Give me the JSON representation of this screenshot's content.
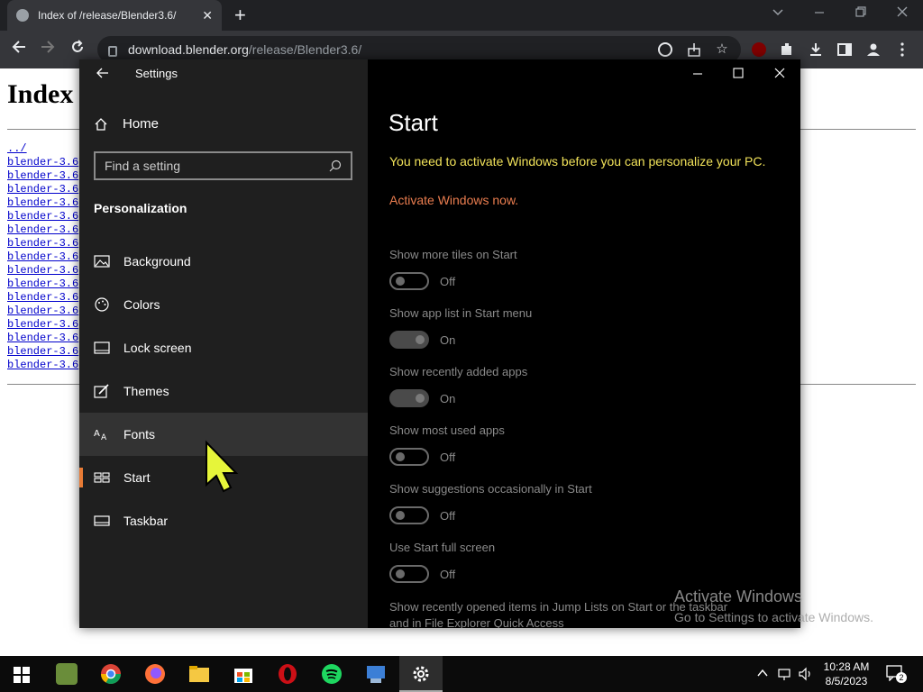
{
  "browser": {
    "tab_title": "Index of /release/Blender3.6/",
    "url_host": "download.blender.org",
    "url_path": "/release/Blender3.6/",
    "new_tab_symbol": "+",
    "close_symbol": "✕"
  },
  "page": {
    "heading": "Index",
    "parent_link": "../",
    "links": [
      "blender-3.6",
      "blender-3.6",
      "blender-3.6",
      "blender-3.6",
      "blender-3.6",
      "blender-3.6",
      "blender-3.6",
      "blender-3.6",
      "blender-3.6",
      "blender-3.6",
      "blender-3.6",
      "blender-3.6",
      "blender-3.6",
      "blender-3.6",
      "blender-3.6",
      "blender-3.6"
    ]
  },
  "settings": {
    "window_title": "Settings",
    "home_label": "Home",
    "search_placeholder": "Find a setting",
    "section_label": "Personalization",
    "menu": [
      {
        "label": "Background",
        "icon": "picture-icon"
      },
      {
        "label": "Colors",
        "icon": "palette-icon"
      },
      {
        "label": "Lock screen",
        "icon": "lock-screen-icon"
      },
      {
        "label": "Themes",
        "icon": "brush-icon"
      },
      {
        "label": "Fonts",
        "icon": "fonts-icon"
      },
      {
        "label": "Start",
        "icon": "start-icon"
      },
      {
        "label": "Taskbar",
        "icon": "taskbar-icon"
      }
    ],
    "active_item": "Start",
    "hover_item": "Fonts",
    "page_heading": "Start",
    "activation_warning": "You need to activate Windows before you can personalize your PC.",
    "activation_link": "Activate Windows now.",
    "options": [
      {
        "label": "Show more tiles on Start",
        "state": "Off"
      },
      {
        "label": "Show app list in Start menu",
        "state": "On"
      },
      {
        "label": "Show recently added apps",
        "state": "On"
      },
      {
        "label": "Show most used apps",
        "state": "Off"
      },
      {
        "label": "Show suggestions occasionally in Start",
        "state": "Off"
      },
      {
        "label": "Use Start full screen",
        "state": "Off"
      }
    ],
    "jump_list_option_line1": "Show recently opened items in Jump Lists on Start or the taskbar",
    "jump_list_option_line2": "and in File Explorer Quick Access"
  },
  "watermark": {
    "title": "Activate Windows",
    "subtitle": "Go to Settings to activate Windows."
  },
  "taskbar": {
    "time": "10:28 AM",
    "date": "8/5/2023",
    "notification_count": "2"
  },
  "colors": {
    "accent": "#e87b35",
    "warning": "#f2e35a",
    "activate_link": "#ea7d4f",
    "cursor": "#e6f53a"
  }
}
